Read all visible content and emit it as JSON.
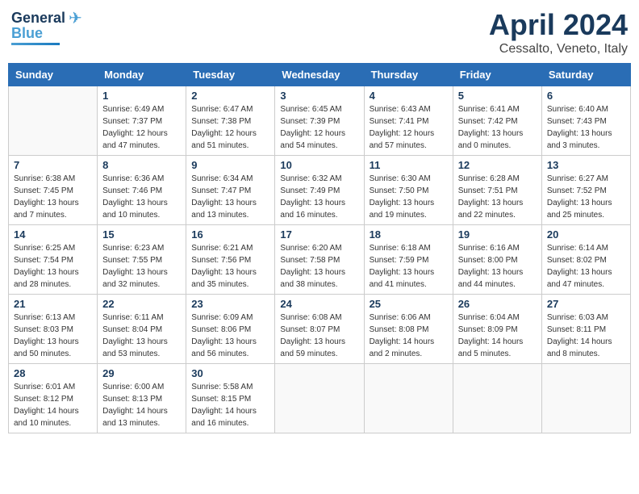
{
  "header": {
    "logo_line1": "General",
    "logo_line2": "Blue",
    "title": "April 2024",
    "subtitle": "Cessalto, Veneto, Italy"
  },
  "days_of_week": [
    "Sunday",
    "Monday",
    "Tuesday",
    "Wednesday",
    "Thursday",
    "Friday",
    "Saturday"
  ],
  "weeks": [
    [
      {
        "day": "",
        "sunrise": "",
        "sunset": "",
        "daylight": ""
      },
      {
        "day": "1",
        "sunrise": "Sunrise: 6:49 AM",
        "sunset": "Sunset: 7:37 PM",
        "daylight": "Daylight: 12 hours and 47 minutes."
      },
      {
        "day": "2",
        "sunrise": "Sunrise: 6:47 AM",
        "sunset": "Sunset: 7:38 PM",
        "daylight": "Daylight: 12 hours and 51 minutes."
      },
      {
        "day": "3",
        "sunrise": "Sunrise: 6:45 AM",
        "sunset": "Sunset: 7:39 PM",
        "daylight": "Daylight: 12 hours and 54 minutes."
      },
      {
        "day": "4",
        "sunrise": "Sunrise: 6:43 AM",
        "sunset": "Sunset: 7:41 PM",
        "daylight": "Daylight: 12 hours and 57 minutes."
      },
      {
        "day": "5",
        "sunrise": "Sunrise: 6:41 AM",
        "sunset": "Sunset: 7:42 PM",
        "daylight": "Daylight: 13 hours and 0 minutes."
      },
      {
        "day": "6",
        "sunrise": "Sunrise: 6:40 AM",
        "sunset": "Sunset: 7:43 PM",
        "daylight": "Daylight: 13 hours and 3 minutes."
      }
    ],
    [
      {
        "day": "7",
        "sunrise": "Sunrise: 6:38 AM",
        "sunset": "Sunset: 7:45 PM",
        "daylight": "Daylight: 13 hours and 7 minutes."
      },
      {
        "day": "8",
        "sunrise": "Sunrise: 6:36 AM",
        "sunset": "Sunset: 7:46 PM",
        "daylight": "Daylight: 13 hours and 10 minutes."
      },
      {
        "day": "9",
        "sunrise": "Sunrise: 6:34 AM",
        "sunset": "Sunset: 7:47 PM",
        "daylight": "Daylight: 13 hours and 13 minutes."
      },
      {
        "day": "10",
        "sunrise": "Sunrise: 6:32 AM",
        "sunset": "Sunset: 7:49 PM",
        "daylight": "Daylight: 13 hours and 16 minutes."
      },
      {
        "day": "11",
        "sunrise": "Sunrise: 6:30 AM",
        "sunset": "Sunset: 7:50 PM",
        "daylight": "Daylight: 13 hours and 19 minutes."
      },
      {
        "day": "12",
        "sunrise": "Sunrise: 6:28 AM",
        "sunset": "Sunset: 7:51 PM",
        "daylight": "Daylight: 13 hours and 22 minutes."
      },
      {
        "day": "13",
        "sunrise": "Sunrise: 6:27 AM",
        "sunset": "Sunset: 7:52 PM",
        "daylight": "Daylight: 13 hours and 25 minutes."
      }
    ],
    [
      {
        "day": "14",
        "sunrise": "Sunrise: 6:25 AM",
        "sunset": "Sunset: 7:54 PM",
        "daylight": "Daylight: 13 hours and 28 minutes."
      },
      {
        "day": "15",
        "sunrise": "Sunrise: 6:23 AM",
        "sunset": "Sunset: 7:55 PM",
        "daylight": "Daylight: 13 hours and 32 minutes."
      },
      {
        "day": "16",
        "sunrise": "Sunrise: 6:21 AM",
        "sunset": "Sunset: 7:56 PM",
        "daylight": "Daylight: 13 hours and 35 minutes."
      },
      {
        "day": "17",
        "sunrise": "Sunrise: 6:20 AM",
        "sunset": "Sunset: 7:58 PM",
        "daylight": "Daylight: 13 hours and 38 minutes."
      },
      {
        "day": "18",
        "sunrise": "Sunrise: 6:18 AM",
        "sunset": "Sunset: 7:59 PM",
        "daylight": "Daylight: 13 hours and 41 minutes."
      },
      {
        "day": "19",
        "sunrise": "Sunrise: 6:16 AM",
        "sunset": "Sunset: 8:00 PM",
        "daylight": "Daylight: 13 hours and 44 minutes."
      },
      {
        "day": "20",
        "sunrise": "Sunrise: 6:14 AM",
        "sunset": "Sunset: 8:02 PM",
        "daylight": "Daylight: 13 hours and 47 minutes."
      }
    ],
    [
      {
        "day": "21",
        "sunrise": "Sunrise: 6:13 AM",
        "sunset": "Sunset: 8:03 PM",
        "daylight": "Daylight: 13 hours and 50 minutes."
      },
      {
        "day": "22",
        "sunrise": "Sunrise: 6:11 AM",
        "sunset": "Sunset: 8:04 PM",
        "daylight": "Daylight: 13 hours and 53 minutes."
      },
      {
        "day": "23",
        "sunrise": "Sunrise: 6:09 AM",
        "sunset": "Sunset: 8:06 PM",
        "daylight": "Daylight: 13 hours and 56 minutes."
      },
      {
        "day": "24",
        "sunrise": "Sunrise: 6:08 AM",
        "sunset": "Sunset: 8:07 PM",
        "daylight": "Daylight: 13 hours and 59 minutes."
      },
      {
        "day": "25",
        "sunrise": "Sunrise: 6:06 AM",
        "sunset": "Sunset: 8:08 PM",
        "daylight": "Daylight: 14 hours and 2 minutes."
      },
      {
        "day": "26",
        "sunrise": "Sunrise: 6:04 AM",
        "sunset": "Sunset: 8:09 PM",
        "daylight": "Daylight: 14 hours and 5 minutes."
      },
      {
        "day": "27",
        "sunrise": "Sunrise: 6:03 AM",
        "sunset": "Sunset: 8:11 PM",
        "daylight": "Daylight: 14 hours and 8 minutes."
      }
    ],
    [
      {
        "day": "28",
        "sunrise": "Sunrise: 6:01 AM",
        "sunset": "Sunset: 8:12 PM",
        "daylight": "Daylight: 14 hours and 10 minutes."
      },
      {
        "day": "29",
        "sunrise": "Sunrise: 6:00 AM",
        "sunset": "Sunset: 8:13 PM",
        "daylight": "Daylight: 14 hours and 13 minutes."
      },
      {
        "day": "30",
        "sunrise": "Sunrise: 5:58 AM",
        "sunset": "Sunset: 8:15 PM",
        "daylight": "Daylight: 14 hours and 16 minutes."
      },
      {
        "day": "",
        "sunrise": "",
        "sunset": "",
        "daylight": ""
      },
      {
        "day": "",
        "sunrise": "",
        "sunset": "",
        "daylight": ""
      },
      {
        "day": "",
        "sunrise": "",
        "sunset": "",
        "daylight": ""
      },
      {
        "day": "",
        "sunrise": "",
        "sunset": "",
        "daylight": ""
      }
    ]
  ]
}
